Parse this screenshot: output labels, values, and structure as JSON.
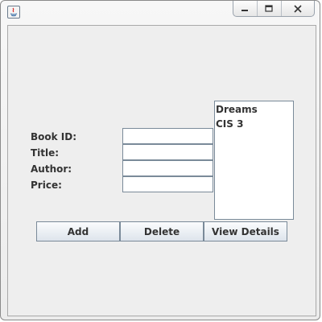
{
  "window": {
    "controls": {
      "minimize": "minimize",
      "maximize": "maximize",
      "close": "close"
    }
  },
  "form": {
    "book_id_label": "Book ID:",
    "title_label": "Title:",
    "author_label": "Author:",
    "price_label": "Price:",
    "book_id_value": "",
    "title_value": "",
    "author_value": "",
    "price_value": ""
  },
  "book_list": {
    "items": [
      "Dreams",
      "CIS 3"
    ]
  },
  "buttons": {
    "add_label": "Add",
    "delete_label": "Delete",
    "view_details_label": "View Details"
  },
  "colors": {
    "panel_background": "#eeeeee",
    "button_gradient_top": "#fbfcfd",
    "button_gradient_bottom": "#dde4ec",
    "border": "#7a8a99"
  }
}
